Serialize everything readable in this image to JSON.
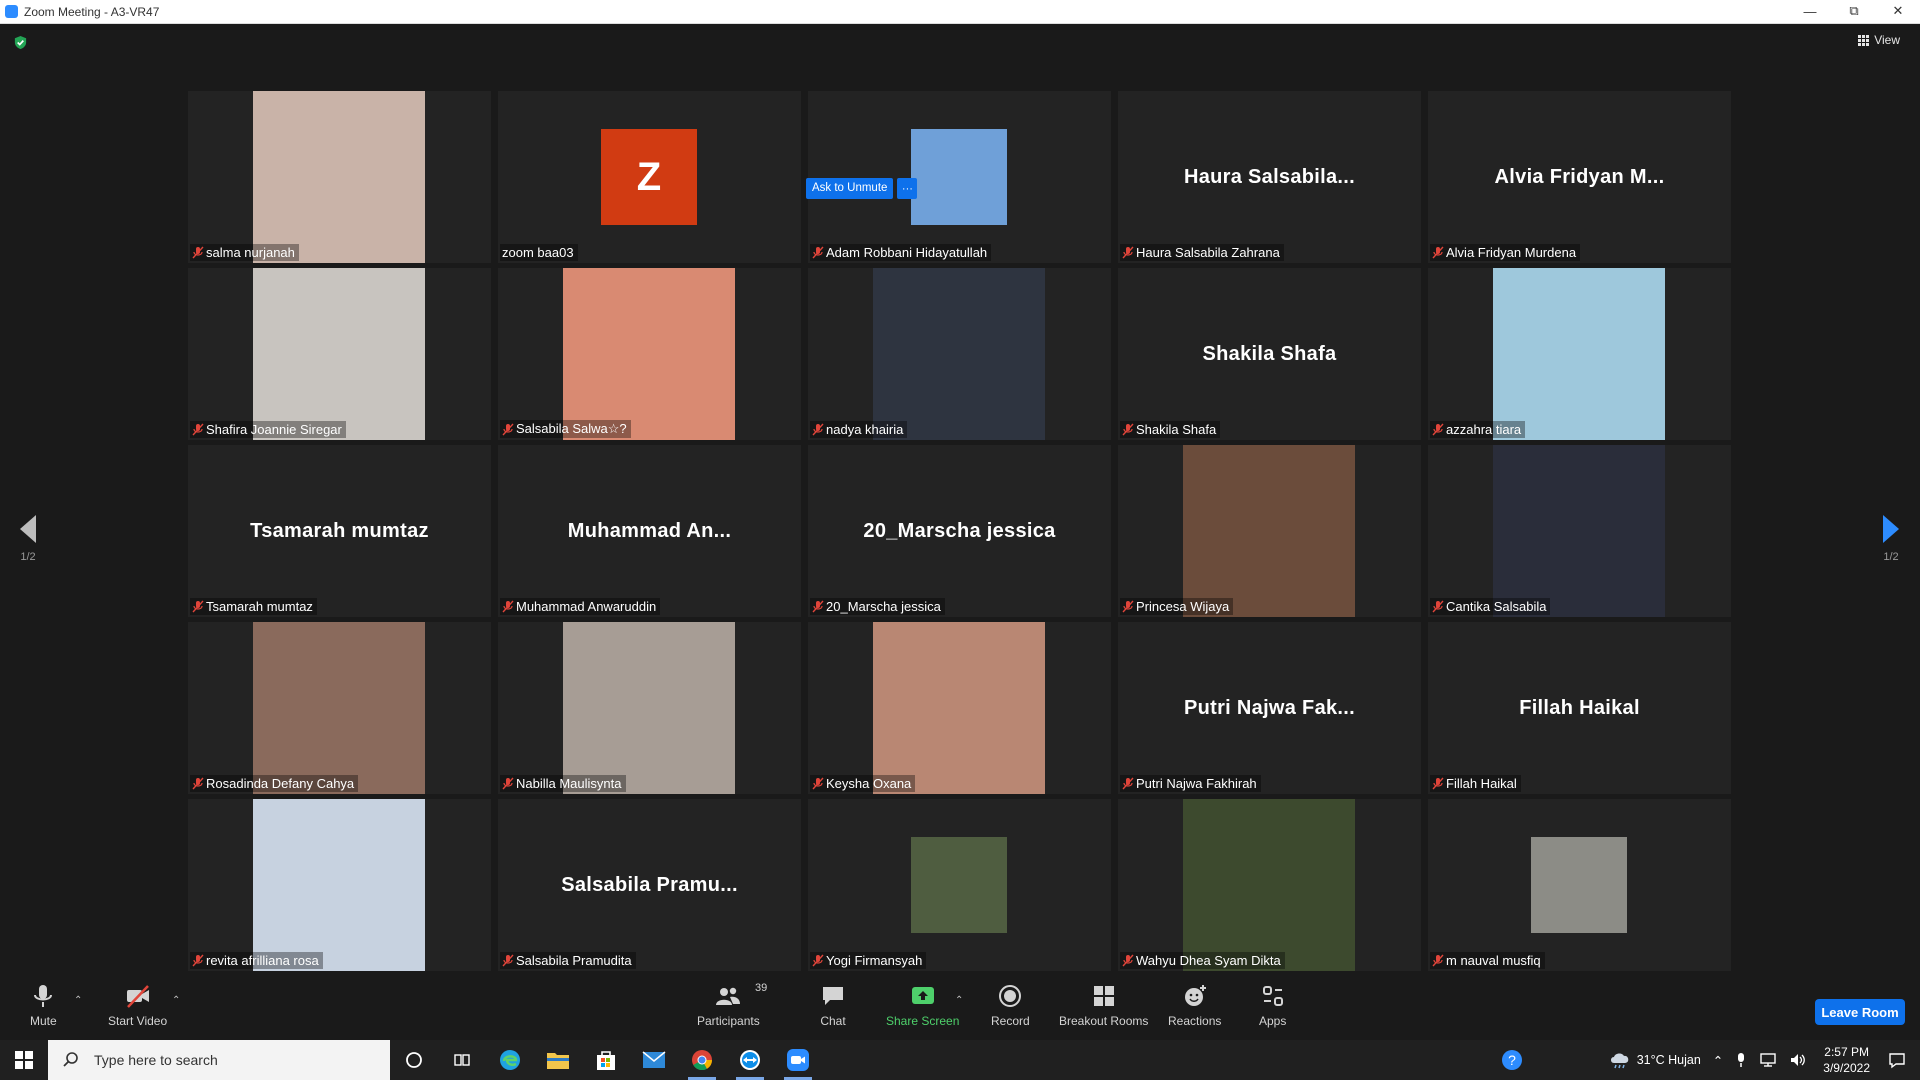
{
  "window": {
    "title": "Zoom Meeting - A3-VR47",
    "controls": [
      "minimize",
      "restore",
      "close"
    ]
  },
  "view_button": {
    "label": "View"
  },
  "pagination": {
    "left": "1/2",
    "right": "1/2"
  },
  "ask_to_unmute": {
    "label": "Ask to Unmute",
    "more": "···"
  },
  "tiles": [
    {
      "name": "salma nurjanah",
      "big": "",
      "kind": "video",
      "bg": "#c9b3a8"
    },
    {
      "name": "zoom baa03",
      "big": "",
      "kind": "avatar",
      "letter": "Z"
    },
    {
      "name": "Adam Robbani Hidayatullah",
      "big": "",
      "kind": "photo-small",
      "bg": "#6fa0d8"
    },
    {
      "name": "Haura Salsabila Zahrana",
      "big": "Haura  Salsabila...",
      "kind": "name"
    },
    {
      "name": "Alvia Fridyan Murdena",
      "big": "Alvia  Fridyan  M...",
      "kind": "name"
    },
    {
      "name": "Shafira Joannie Siregar",
      "big": "",
      "kind": "video",
      "bg": "#c8c4bf"
    },
    {
      "name": "Salsabila Salwa☆?",
      "big": "",
      "kind": "video",
      "bg": "#d98a72"
    },
    {
      "name": "nadya khairia",
      "big": "",
      "kind": "video",
      "bg": "#2e3440"
    },
    {
      "name": "Shakila Shafa",
      "big": "Shakila Shafa",
      "kind": "name"
    },
    {
      "name": "azzahra tiara",
      "big": "",
      "kind": "video",
      "bg": "#9ec8dc"
    },
    {
      "name": "Tsamarah mumtaz",
      "big": "Tsamarah mumtaz",
      "kind": "name"
    },
    {
      "name": "Muhammad Anwaruddin",
      "big": "Muhammad  An...",
      "kind": "name"
    },
    {
      "name": "20_Marscha jessica",
      "big": "20_Marscha jessica",
      "kind": "name"
    },
    {
      "name": "Princesa Wijaya",
      "big": "",
      "kind": "video",
      "bg": "#6b4c3b"
    },
    {
      "name": "Cantika Salsabila",
      "big": "",
      "kind": "video",
      "bg": "#2a2d3a"
    },
    {
      "name": "Rosadinda Defany Cahya",
      "big": "",
      "kind": "video",
      "bg": "#8a6a5c"
    },
    {
      "name": "Nabilla Maulisynta",
      "big": "",
      "kind": "video",
      "bg": "#a79d95"
    },
    {
      "name": "Keysha Oxana",
      "big": "",
      "kind": "video",
      "bg": "#b98773"
    },
    {
      "name": "Putri Najwa Fakhirah",
      "big": "Putri  Najwa  Fak...",
      "kind": "name"
    },
    {
      "name": "Fillah Haikal",
      "big": "Fillah Haikal",
      "kind": "name"
    },
    {
      "name": "revita afrilliana rosa",
      "big": "",
      "kind": "video",
      "bg": "#c7d2e0"
    },
    {
      "name": "Salsabila Pramudita",
      "big": "Salsabila  Pramu...",
      "kind": "name"
    },
    {
      "name": "Yogi Firmansyah",
      "big": "",
      "kind": "photo-small",
      "bg": "#4f5d40"
    },
    {
      "name": "Wahyu Dhea Syam Dikta",
      "big": "",
      "kind": "video",
      "bg": "#3d4a2e"
    },
    {
      "name": "m nauval musfiq",
      "big": "",
      "kind": "photo-small",
      "bg": "#8c8c86"
    }
  ],
  "toolbar": {
    "mute": "Mute",
    "start_video": "Start Video",
    "participants": "Participants",
    "participant_count": "39",
    "chat": "Chat",
    "share_screen": "Share Screen",
    "record": "Record",
    "breakout_rooms": "Breakout Rooms",
    "reactions": "Reactions",
    "apps": "Apps",
    "leave": "Leave Room"
  },
  "taskbar": {
    "search_placeholder": "Type here to search",
    "weather": "31°C  Hujan",
    "time": "2:57 PM",
    "date": "3/9/2022"
  },
  "colors": {
    "accent": "#0e71eb",
    "share_green": "#4ed06b",
    "muted_red": "#e0453a",
    "tile_bg": "#232323"
  }
}
